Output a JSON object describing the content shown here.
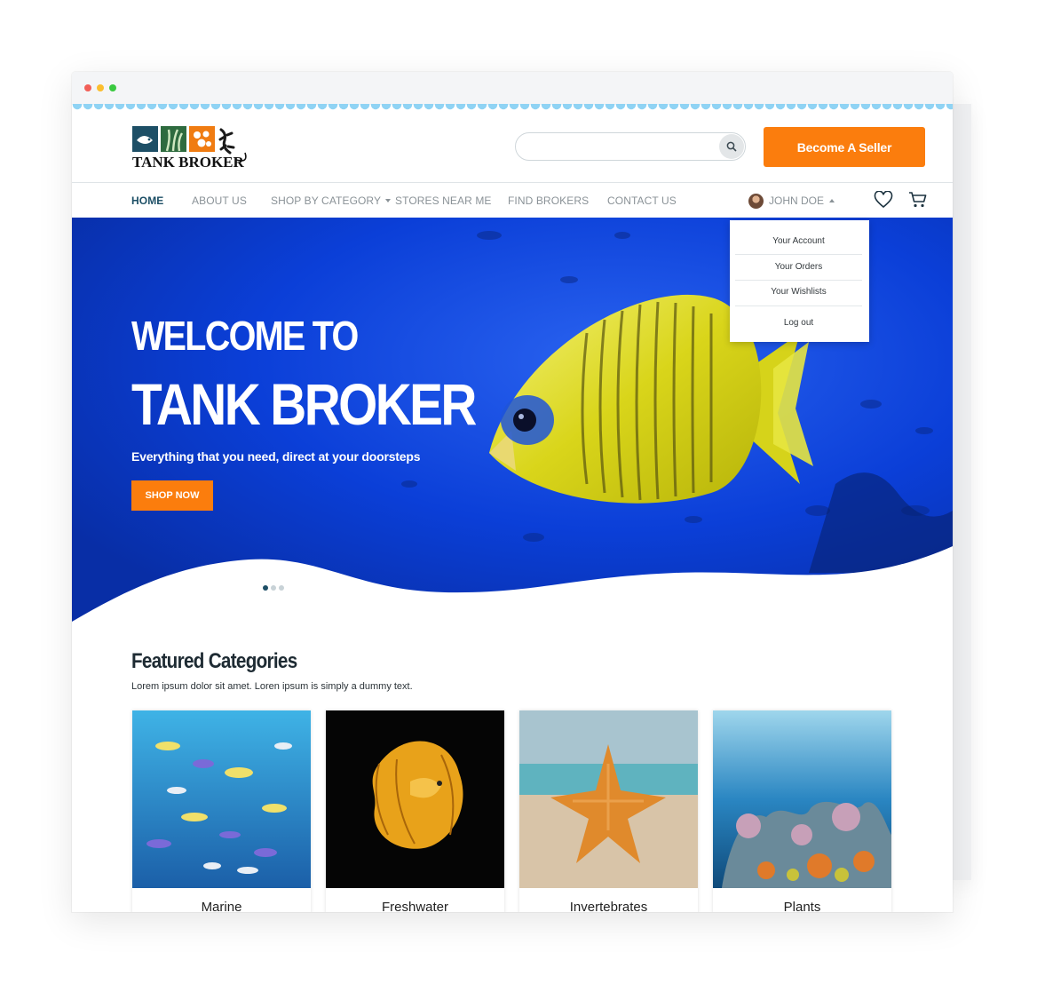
{
  "brand": {
    "name": "TANK BROKER",
    "colors": {
      "accent": "#fb7d0d",
      "nav_active": "#1d4f66",
      "hero_blue": "#0b3fd8",
      "scallop": "#8fd3f4"
    }
  },
  "header": {
    "search": {
      "placeholder": "",
      "icon": "search-icon"
    },
    "seller_button": "Become A Seller"
  },
  "nav": {
    "items": [
      {
        "label": "HOME",
        "active": true
      },
      {
        "label": "ABOUT US"
      },
      {
        "label": "SHOP BY CATEGORY",
        "has_dropdown": true
      },
      {
        "label": "STORES NEAR ME"
      },
      {
        "label": "FIND BROKERS"
      },
      {
        "label": "CONTACT US"
      }
    ],
    "user": {
      "name": "JOHN DOE",
      "icon": "avatar"
    },
    "icons": [
      "heart-icon",
      "cart-icon"
    ]
  },
  "user_menu": {
    "items": [
      "Your Account",
      "Your Orders",
      "Your Wishlists",
      "Log out"
    ]
  },
  "hero": {
    "line1": "WELCOME TO",
    "line2": "TANK BROKER",
    "subtitle": "Everything that you need, direct at your doorsteps",
    "cta": "SHOP NOW",
    "slides": {
      "count": 3,
      "active": 1
    }
  },
  "featured": {
    "title": "Featured Categories",
    "subtitle": "Lorem ipsum dolor sit amet. Loren ipsum is simply a dummy text.",
    "categories": [
      {
        "label": "Marine"
      },
      {
        "label": "Freshwater"
      },
      {
        "label": "Invertebrates"
      },
      {
        "label": "Plants"
      }
    ]
  }
}
